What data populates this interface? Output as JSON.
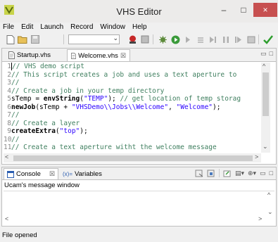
{
  "window": {
    "title": "VHS Editor",
    "minimize": "–",
    "maximize": "□",
    "close": "×"
  },
  "menu": [
    "File",
    "Edit",
    "Launch",
    "Record",
    "Window",
    "Help"
  ],
  "toolbar": {
    "combo_value": ""
  },
  "editor": {
    "tabs": [
      {
        "label": "Startup.vhs",
        "active": false
      },
      {
        "label": "Welcome.vhs",
        "active": true,
        "close": "☒"
      }
    ],
    "lines": [
      {
        "n": "1",
        "parts": [
          {
            "t": "// VHS demo script",
            "c": "c"
          }
        ]
      },
      {
        "n": "2",
        "parts": [
          {
            "t": "// This script creates a job and uses a text aperture to",
            "c": "c"
          }
        ]
      },
      {
        "n": "3",
        "parts": [
          {
            "t": "//",
            "c": "c"
          }
        ]
      },
      {
        "n": "4",
        "parts": [
          {
            "t": "// Create a job in your temp directory",
            "c": "c"
          }
        ]
      },
      {
        "n": "5",
        "parts": [
          {
            "t": "sTemp = ",
            "c": "p"
          },
          {
            "t": "envString",
            "c": "k"
          },
          {
            "t": "(",
            "c": "p"
          },
          {
            "t": "\"TEMP\"",
            "c": "s"
          },
          {
            "t": "); ",
            "c": "p"
          },
          {
            "t": "// get location of temp storag",
            "c": "c"
          }
        ]
      },
      {
        "n": "6",
        "parts": [
          {
            "t": "newJob",
            "c": "k"
          },
          {
            "t": "(sTemp + ",
            "c": "p"
          },
          {
            "t": "\"VHSDemo\\\\Jobs\\\\Welcome\"",
            "c": "s"
          },
          {
            "t": ", ",
            "c": "p"
          },
          {
            "t": "\"Welcome\"",
            "c": "s"
          },
          {
            "t": ");",
            "c": "p"
          }
        ]
      },
      {
        "n": "7",
        "parts": [
          {
            "t": "//",
            "c": "c"
          }
        ]
      },
      {
        "n": "8",
        "parts": [
          {
            "t": "// Create a layer",
            "c": "c"
          }
        ]
      },
      {
        "n": "9",
        "parts": [
          {
            "t": "createExtra",
            "c": "k"
          },
          {
            "t": "(",
            "c": "p"
          },
          {
            "t": "\"top\"",
            "c": "s"
          },
          {
            "t": ");",
            "c": "p"
          }
        ]
      },
      {
        "n": "10",
        "parts": [
          {
            "t": "//",
            "c": "c"
          }
        ]
      },
      {
        "n": "11",
        "parts": [
          {
            "t": "// Create a text aperture witht the welcome message",
            "c": "c"
          }
        ]
      }
    ]
  },
  "console": {
    "tabs": [
      {
        "label": "Console",
        "close": "☒"
      },
      {
        "label": "Variables",
        "prefix": "(x)="
      }
    ],
    "title": "Ucam's message window"
  },
  "status": "File opened"
}
